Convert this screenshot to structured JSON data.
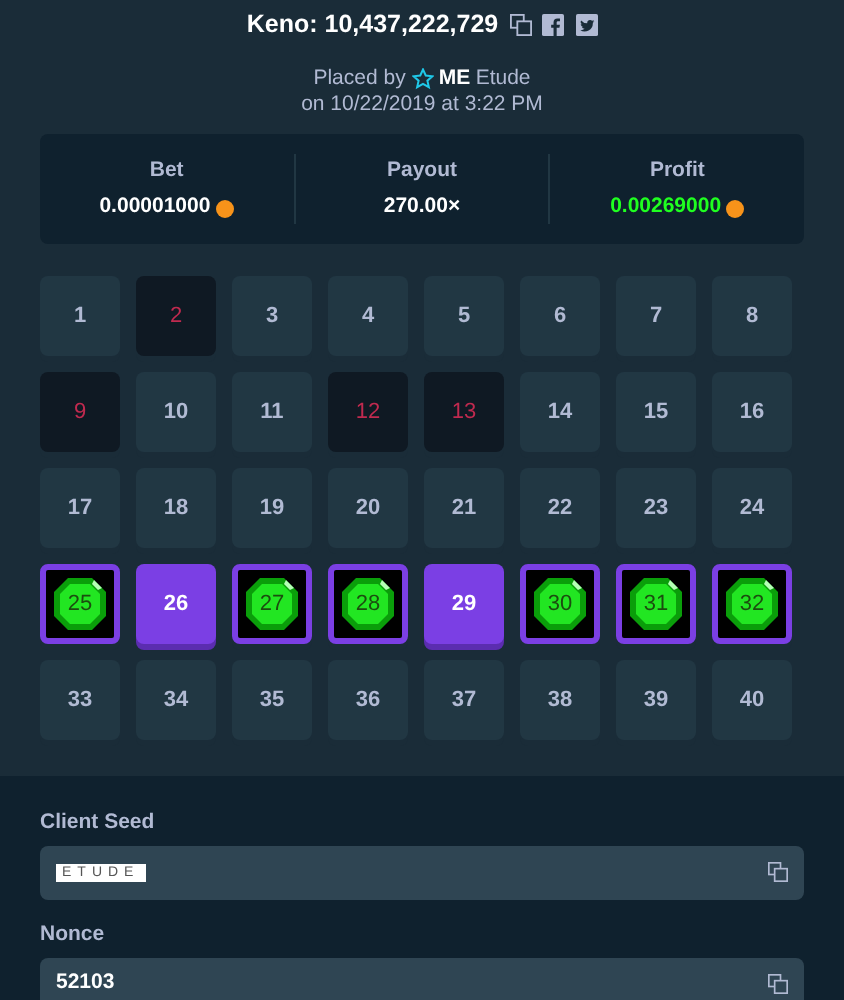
{
  "header": {
    "title": "Keno: 10,437,222,729",
    "placed_by_label": "Placed by",
    "user_badge": "ME",
    "user_name": "Etude",
    "date": "on 10/22/2019 at 3:22 PM"
  },
  "stats": [
    {
      "label": "Bet",
      "value": "0.00001000",
      "coin": true,
      "kind": "plain"
    },
    {
      "label": "Payout",
      "value": "270.00×",
      "coin": false,
      "kind": "plain"
    },
    {
      "label": "Profit",
      "value": "0.00269000",
      "coin": true,
      "kind": "positive"
    }
  ],
  "tiles": [
    {
      "number": "1",
      "picked": false,
      "drawn": false
    },
    {
      "number": "2",
      "picked": false,
      "drawn": true
    },
    {
      "number": "3",
      "picked": false,
      "drawn": false
    },
    {
      "number": "4",
      "picked": false,
      "drawn": false
    },
    {
      "number": "5",
      "picked": false,
      "drawn": false
    },
    {
      "number": "6",
      "picked": false,
      "drawn": false
    },
    {
      "number": "7",
      "picked": false,
      "drawn": false
    },
    {
      "number": "8",
      "picked": false,
      "drawn": false
    },
    {
      "number": "9",
      "picked": false,
      "drawn": true
    },
    {
      "number": "10",
      "picked": false,
      "drawn": false
    },
    {
      "number": "11",
      "picked": false,
      "drawn": false
    },
    {
      "number": "12",
      "picked": false,
      "drawn": true
    },
    {
      "number": "13",
      "picked": false,
      "drawn": true
    },
    {
      "number": "14",
      "picked": false,
      "drawn": false
    },
    {
      "number": "15",
      "picked": false,
      "drawn": false
    },
    {
      "number": "16",
      "picked": false,
      "drawn": false
    },
    {
      "number": "17",
      "picked": false,
      "drawn": false
    },
    {
      "number": "18",
      "picked": false,
      "drawn": false
    },
    {
      "number": "19",
      "picked": false,
      "drawn": false
    },
    {
      "number": "20",
      "picked": false,
      "drawn": false
    },
    {
      "number": "21",
      "picked": false,
      "drawn": false
    },
    {
      "number": "22",
      "picked": false,
      "drawn": false
    },
    {
      "number": "23",
      "picked": false,
      "drawn": false
    },
    {
      "number": "24",
      "picked": false,
      "drawn": false
    },
    {
      "number": "25",
      "picked": true,
      "drawn": true
    },
    {
      "number": "26",
      "picked": true,
      "drawn": false
    },
    {
      "number": "27",
      "picked": true,
      "drawn": true
    },
    {
      "number": "28",
      "picked": true,
      "drawn": true
    },
    {
      "number": "29",
      "picked": true,
      "drawn": false
    },
    {
      "number": "30",
      "picked": true,
      "drawn": true
    },
    {
      "number": "31",
      "picked": true,
      "drawn": true
    },
    {
      "number": "32",
      "picked": true,
      "drawn": true
    },
    {
      "number": "33",
      "picked": false,
      "drawn": false
    },
    {
      "number": "34",
      "picked": false,
      "drawn": false
    },
    {
      "number": "35",
      "picked": false,
      "drawn": false
    },
    {
      "number": "36",
      "picked": false,
      "drawn": false
    },
    {
      "number": "37",
      "picked": false,
      "drawn": false
    },
    {
      "number": "38",
      "picked": false,
      "drawn": false
    },
    {
      "number": "39",
      "picked": false,
      "drawn": false
    },
    {
      "number": "40",
      "picked": false,
      "drawn": false
    }
  ],
  "fields": [
    {
      "label": "Client Seed",
      "value": "ETUDE",
      "kind": "boxed"
    },
    {
      "label": "Nonce",
      "value": "52103",
      "kind": "plain"
    }
  ]
}
